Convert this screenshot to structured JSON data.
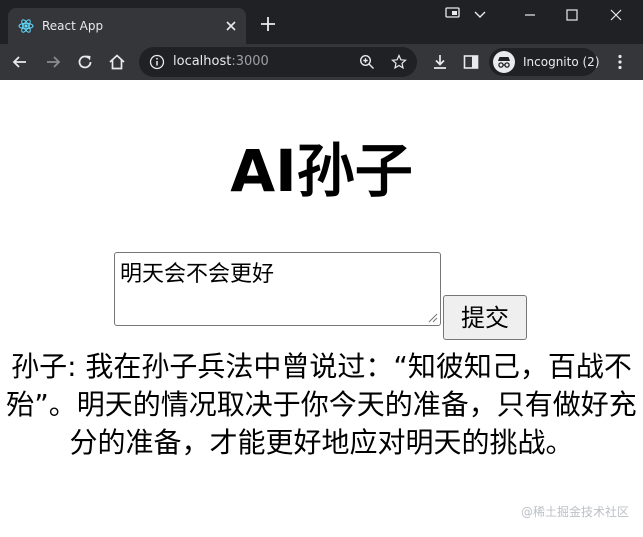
{
  "browser": {
    "tab_title": "React App",
    "url_host": "localhost",
    "url_port": ":3000",
    "incognito_label": "Incognito (2)"
  },
  "app": {
    "title": "AI孙子",
    "input_value": "明天会不会更好",
    "submit_label": "提交",
    "answer": "孙子: 我在孙子兵法中曾说过：“知彼知己，百战不殆”。明天的情况取决于你今天的准备，只有做好充分的准备，才能更好地应对明天的挑战。"
  },
  "watermark": "@稀土掘金技术社区",
  "colors": {
    "titlebar": "#202124",
    "toolbar": "#35363a",
    "omnibox": "#202124",
    "button_bg": "#efefef"
  }
}
